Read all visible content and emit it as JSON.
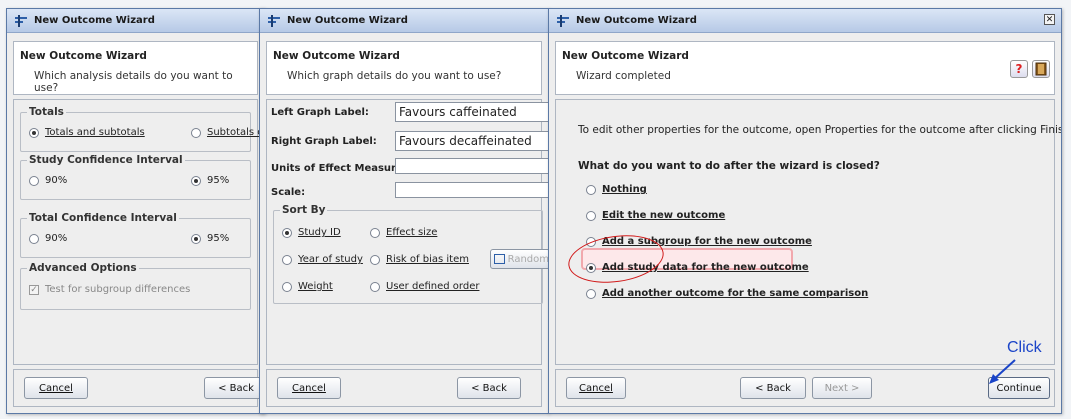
{
  "colors": {
    "titlebar": "#c6d6ee",
    "highlight": "#fde8ea",
    "annotation_red": "#d11a1a",
    "annotation_blue": "#1a44c8"
  },
  "icons": {
    "window": "wizard-window-icon",
    "close": "close-icon",
    "help": "help-icon",
    "book": "book-icon",
    "arrow": "arrow-icon"
  },
  "dialog1": {
    "window_title": "New Outcome Wizard",
    "header_title": "New Outcome Wizard",
    "header_subtitle": "Which analysis details do you want to use?",
    "totals": {
      "title": "Totals",
      "opt1": "Totals and subtotals",
      "opt2": "Subtotals only",
      "selected": "opt1"
    },
    "study_ci": {
      "title": "Study Confidence Interval",
      "opt1": "90%",
      "opt2": "95%",
      "selected": "opt2"
    },
    "total_ci": {
      "title": "Total Confidence Interval",
      "opt1": "90%",
      "opt2": "95%",
      "selected": "opt2"
    },
    "advanced": {
      "title": "Advanced Options",
      "checkbox": "Test for subgroup differences",
      "checked": true
    },
    "cancel": "Cancel",
    "back": "< Back"
  },
  "dialog2": {
    "window_title": "New Outcome Wizard",
    "header_title": "New Outcome Wizard",
    "header_subtitle": "Which graph details do you want to use?",
    "left_label": "Left Graph Label:",
    "left_value": "Favours caffeinated",
    "right_label": "Right Graph Label:",
    "right_value": "Favours decaffeinated",
    "units_label": "Units of Effect Measure:",
    "units_value": "",
    "scale_label": "Scale:",
    "scale_value": "",
    "sort_by": {
      "title": "Sort By",
      "study_id": "Study ID",
      "effect_size": "Effect size",
      "year": "Year of study",
      "risk_of_bias": "Risk of bias item",
      "weight": "Weight",
      "user_defined": "User defined order",
      "random_button": "Random",
      "selected": "study_id"
    },
    "cancel": "Cancel",
    "back": "< Back"
  },
  "dialog3": {
    "window_title": "New Outcome Wizard",
    "header_title": "New Outcome Wizard",
    "header_subtitle": "Wizard completed",
    "info": "To edit other properties for the outcome, open Properties for the outcome after clicking Finish.",
    "question": "What do you want to do after the wizard is closed?",
    "options": [
      "Nothing",
      "Edit the new outcome",
      "Add a subgroup for the new outcome",
      "Add study data for the new outcome",
      "Add another outcome for the same comparison"
    ],
    "selected_index": 3,
    "cancel": "Cancel",
    "back": "< Back",
    "next": "Next >",
    "continue": "Continue"
  },
  "annotation": {
    "click_label": "Click"
  }
}
